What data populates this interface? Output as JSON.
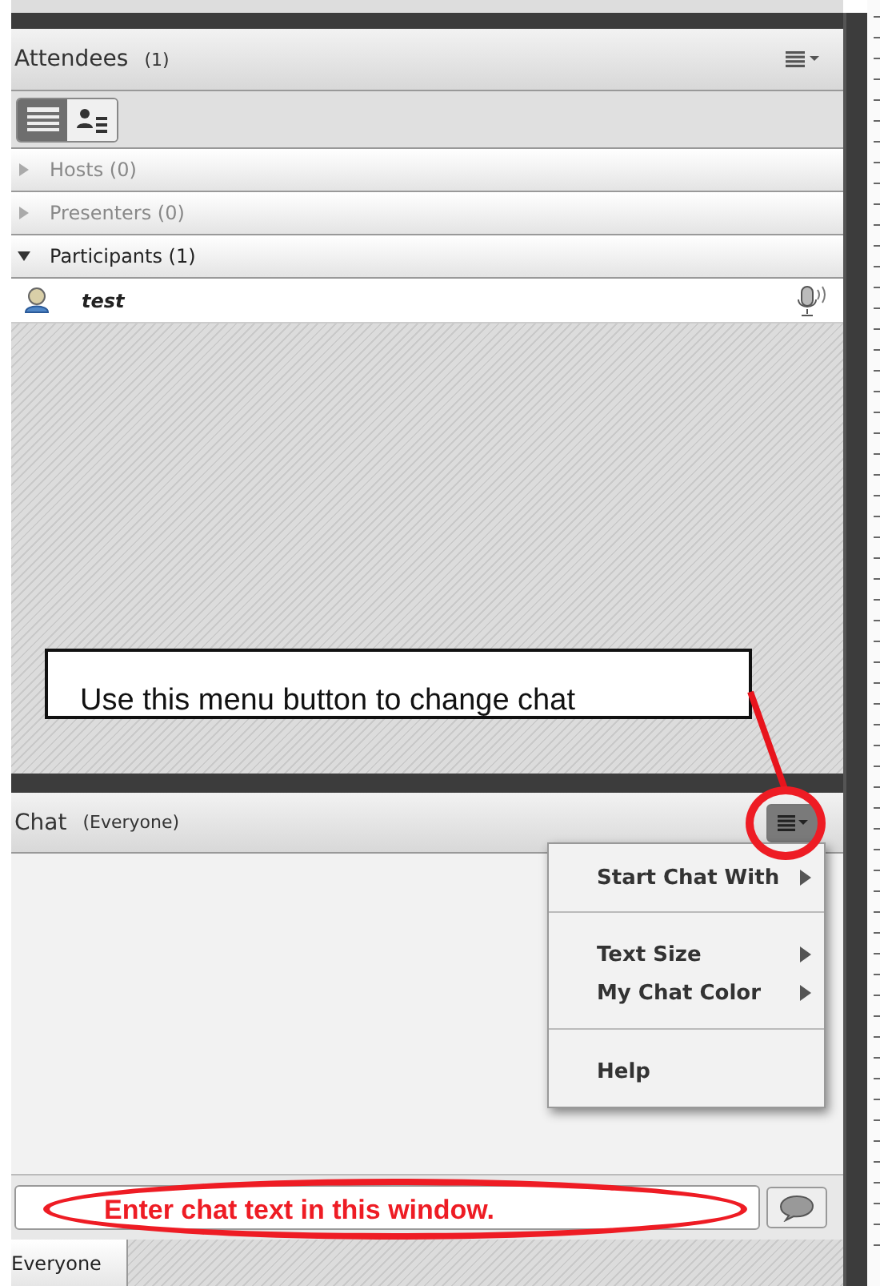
{
  "attendees": {
    "title": "Attendees",
    "count": "(1)",
    "views": [
      {
        "kind": "list",
        "selected": true
      },
      {
        "kind": "cards",
        "selected": false
      }
    ],
    "groups": [
      {
        "label": "Hosts (0)",
        "expanded": false,
        "disabled": true
      },
      {
        "label": "Presenters (0)",
        "expanded": false,
        "disabled": true
      },
      {
        "label": "Participants (1)",
        "expanded": true,
        "disabled": false,
        "children": [
          {
            "name": "test",
            "speaking": true
          }
        ]
      }
    ]
  },
  "callouts": [
    {
      "kind": "box",
      "text": "Use this menu button to change chat"
    },
    {
      "kind": "ellipse",
      "text": "Enter chat text in this window."
    }
  ],
  "chat": {
    "title": "Chat",
    "scope": "(Everyone)",
    "menu_open": true,
    "menu_sections": [
      {
        "items": [
          {
            "label": "Start Chat With",
            "submenu": true
          }
        ]
      },
      {
        "items": [
          {
            "label": "Text Size",
            "submenu": true
          },
          {
            "label": "My Chat Color",
            "submenu": true
          }
        ]
      },
      {
        "items": [
          {
            "label": "Help",
            "submenu": false
          }
        ]
      }
    ]
  },
  "tabs": [
    {
      "label": "Everyone",
      "selected": true
    }
  ]
}
